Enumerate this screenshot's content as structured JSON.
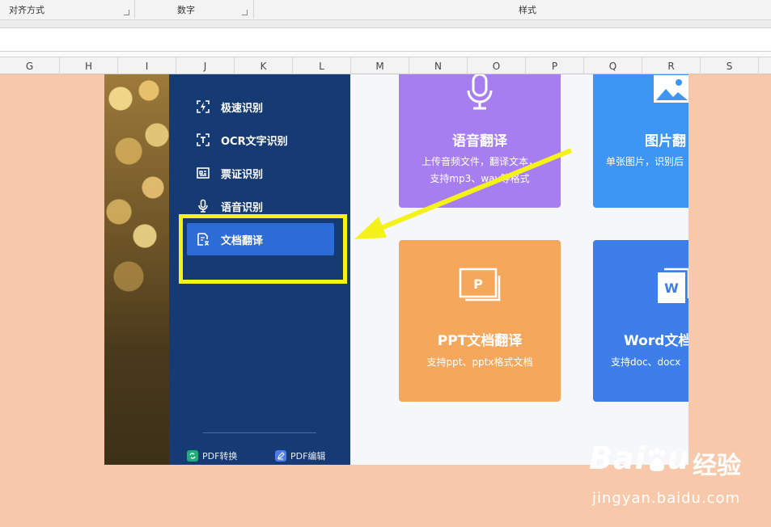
{
  "ribbon": {
    "groups": [
      {
        "label": "对齐方式"
      },
      {
        "label": "数字"
      },
      {
        "label": "样式"
      }
    ]
  },
  "columns": [
    "G",
    "H",
    "I",
    "J",
    "K",
    "L",
    "M",
    "N",
    "O",
    "P",
    "Q",
    "R",
    "S"
  ],
  "sidebar": {
    "items": [
      {
        "label": "极速识别",
        "icon": "lightning-scan-icon"
      },
      {
        "label": "OCR文字识别",
        "icon": "ocr-text-icon"
      },
      {
        "label": "票证识别",
        "icon": "ticket-icon"
      },
      {
        "label": "语音识别",
        "icon": "microphone-icon"
      },
      {
        "label": "文档翻译",
        "icon": "document-translate-icon",
        "active": true
      }
    ],
    "bottom": [
      {
        "label": "PDF转换",
        "icon": "pdf-convert-icon",
        "color": "#1fae7a"
      },
      {
        "label": "PDF编辑",
        "icon": "pdf-edit-icon",
        "color": "#4c7de8"
      }
    ]
  },
  "cards": [
    {
      "title": "语音翻译",
      "desc": "上传音频文件，翻译文本，\n支持mp3、wav等格式",
      "color": "#a77ef0",
      "icon": "microphone-icon"
    },
    {
      "title": "图片翻",
      "desc": "单张图片，识别后",
      "color": "#3d96f3",
      "icon": "image-icon"
    },
    {
      "title": "PPT文档翻译",
      "desc": "支持ppt、pptx格式文档",
      "color": "#f5a85c",
      "icon": "ppt-icon",
      "icon_letter": "P"
    },
    {
      "title": "Word文档",
      "desc": "支持doc、docx",
      "color": "#3d7ee8",
      "icon": "word-icon",
      "icon_letter": "W"
    }
  ],
  "watermark": {
    "brand": "Bai",
    "brand_end": "u",
    "cn": "经验",
    "url": "jingyan.baidu.com"
  },
  "colors": {
    "background": "#f7c9aa",
    "sidebar": "#163a73",
    "active_item": "#2d6bd6",
    "highlight": "#f5f219"
  }
}
